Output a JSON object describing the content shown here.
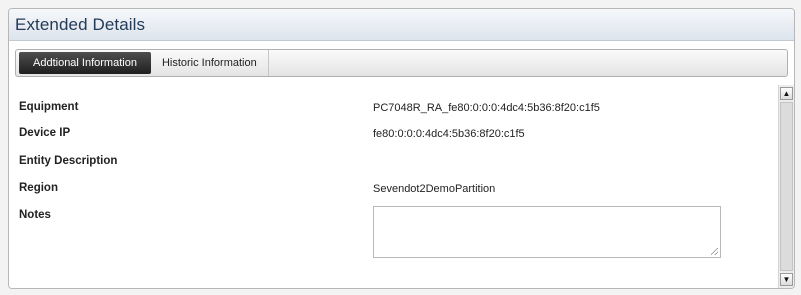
{
  "panel": {
    "title": "Extended Details"
  },
  "tabs": [
    {
      "label": "Addtional Information",
      "active": true
    },
    {
      "label": "Historic Information",
      "active": false
    }
  ],
  "fields": {
    "equipment": {
      "label": "Equipment",
      "value": "PC7048R_RA_fe80:0:0:0:4dc4:5b36:8f20:c1f5"
    },
    "device_ip": {
      "label": "Device IP",
      "value": "fe80:0:0:0:4dc4:5b36:8f20:c1f5"
    },
    "entity_description": {
      "label": "Entity Description",
      "value": ""
    },
    "region": {
      "label": "Region",
      "value": "Sevendot2DemoPartition"
    },
    "notes": {
      "label": "Notes",
      "value": ""
    }
  },
  "scrollbar": {
    "up_icon": "arrow-up-icon",
    "down_icon": "arrow-down-icon"
  }
}
